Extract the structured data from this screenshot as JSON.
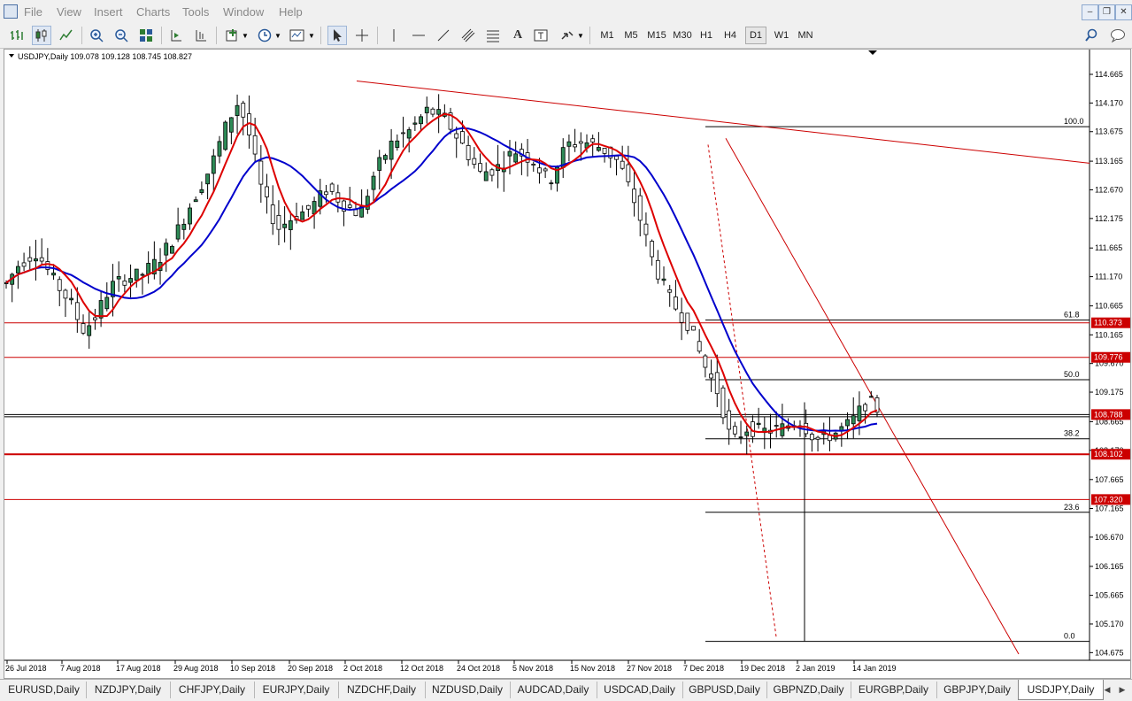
{
  "menu": [
    "File",
    "View",
    "Insert",
    "Charts",
    "Tools",
    "Window",
    "Help"
  ],
  "timeframes": [
    "M1",
    "M5",
    "M15",
    "M30",
    "H1",
    "H4",
    "D1",
    "W1",
    "MN"
  ],
  "active_timeframe": "D1",
  "chart": {
    "header": "USDJPY,Daily  109.078 109.128 108.745 108.827",
    "price_ticks": [
      "114.665",
      "114.170",
      "113.675",
      "113.165",
      "112.670",
      "112.175",
      "111.665",
      "111.170",
      "110.665",
      "110.165",
      "109.670",
      "109.175",
      "108.665",
      "108.170",
      "107.665",
      "107.165",
      "106.670",
      "106.165",
      "105.665",
      "105.170",
      "104.675"
    ],
    "date_labels": [
      "26 Jul 2018",
      "7 Aug 2018",
      "17 Aug 2018",
      "29 Aug 2018",
      "10 Sep 2018",
      "20 Sep 2018",
      "2 Oct 2018",
      "12 Oct 2018",
      "24 Oct 2018",
      "5 Nov 2018",
      "15 Nov 2018",
      "27 Nov 2018",
      "7 Dec 2018",
      "19 Dec 2018",
      "2 Jan 2019",
      "14 Jan 2019"
    ],
    "fib_levels": [
      {
        "label": "100.0",
        "price": 113.76
      },
      {
        "label": "61.8",
        "price": 110.42
      },
      {
        "label": "50.0",
        "price": 109.39
      },
      {
        "label": "38.2",
        "price": 108.37
      },
      {
        "label": "23.6",
        "price": 107.1
      },
      {
        "label": "0.0",
        "price": 104.87
      }
    ],
    "price_badges": [
      {
        "label": "110.373",
        "price": 110.373,
        "color": "#cc0000"
      },
      {
        "label": "109.776",
        "price": 109.776,
        "color": "#cc0000"
      },
      {
        "label": "108.788",
        "price": 108.788,
        "color": "#cc0000"
      },
      {
        "label": "108.102",
        "price": 108.102,
        "color": "#cc0000"
      },
      {
        "label": "107.320",
        "price": 107.32,
        "color": "#cc0000"
      }
    ],
    "horizontal_lines": [
      {
        "price": 110.373,
        "color": "#cc0000",
        "width": 1
      },
      {
        "price": 109.776,
        "color": "#cc0000",
        "width": 1
      },
      {
        "price": 108.788,
        "color": "#000000",
        "width": 1
      },
      {
        "price": 108.102,
        "color": "#cc0000",
        "width": 2
      },
      {
        "price": 107.32,
        "color": "#cc0000",
        "width": 1
      }
    ],
    "colors": {
      "bull": "#2e8b57",
      "bear": "#ffffff",
      "ma_fast": "#dd0000",
      "ma_slow": "#0000cc",
      "trendline": "#cc0000"
    }
  },
  "tabs": [
    "EURUSD,Daily",
    "NZDJPY,Daily",
    "CHFJPY,Daily",
    "EURJPY,Daily",
    "NZDCHF,Daily",
    "NZDUSD,Daily",
    "AUDCAD,Daily",
    "USDCAD,Daily",
    "GBPUSD,Daily",
    "GBPNZD,Daily",
    "EURGBP,Daily",
    "GBPJPY,Daily",
    "USDJPY,Daily"
  ],
  "active_tab": "USDJPY,Daily"
}
